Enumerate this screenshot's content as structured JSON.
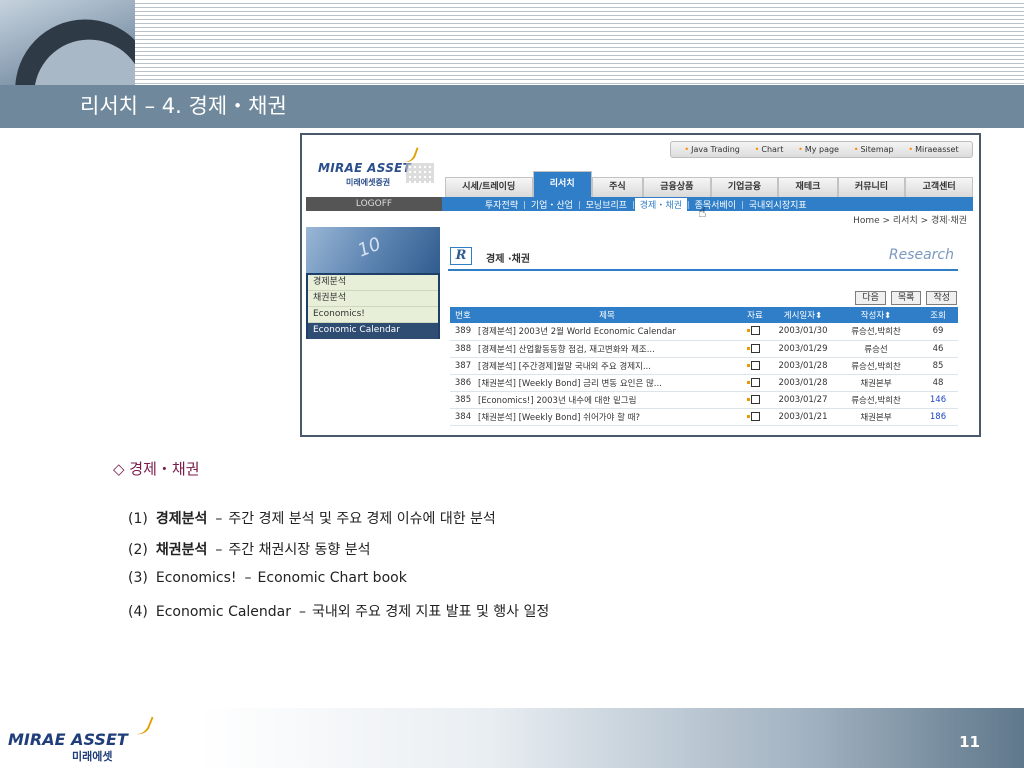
{
  "slide": {
    "title": "리서치 – 4. 경제・채권",
    "section_heading": "◇ 경제・채권",
    "bullets": [
      {
        "num": "(1)",
        "term": "경제분석",
        "dash": "–",
        "desc": "주간 경제 분석 및 주요 경제 이슈에 대한 분석"
      },
      {
        "num": "(2)",
        "term": "채권분석",
        "dash": "–",
        "desc": "주간 채권시장 동향 분석"
      },
      {
        "num": "(3)",
        "term": "Economics!",
        "dash": "–",
        "desc": "Economic Chart book"
      },
      {
        "num": "(4)",
        "term": "Economic Calendar",
        "dash": "–",
        "desc": "국내외 주요 경제 지표 발표 및 행사 일정"
      }
    ],
    "page_number": "11",
    "footer_logo": {
      "main": "MIRAE ASSET",
      "sub": "미래에셋"
    }
  },
  "site": {
    "logo": {
      "main": "MIRAE ASSET",
      "sub": "미래에셋증권"
    },
    "top_links": [
      "Java Trading",
      "Chart",
      "My page",
      "Sitemap",
      "Miraeasset"
    ],
    "main_nav": [
      "시세/트레이딩",
      "리서치",
      "주식",
      "금융상품",
      "기업금융",
      "재테크",
      "커뮤니티",
      "고객센터"
    ],
    "main_nav_active_index": 1,
    "logoff": "LOGOFF",
    "sub_nav": [
      "투자전략",
      "기업・산업",
      "모닝브리프",
      "경제・채권",
      "종목서베이",
      "국내외시장지표"
    ],
    "sub_nav_active_index": 3,
    "breadcrumb": "Home > 리서치 > 경제·채권",
    "side_menu": [
      "경제분석",
      "채권분석",
      "Economics!",
      "Economic Calendar"
    ],
    "side_photo_text": "10",
    "content_title": "경제 ·채권",
    "badge_letter": "R",
    "research_label": "Research",
    "buttons": [
      "다음",
      "목록",
      "작성"
    ],
    "table": {
      "headers": [
        "번호",
        "제목",
        "자료",
        "게시일자",
        "작성자",
        "조회"
      ],
      "rows": [
        {
          "no": "389",
          "title": "[경제분석] 2003년 2월 World Economic Calendar",
          "date": "2003/01/30",
          "author": "류승선,박희찬",
          "views": "69",
          "highlight": false
        },
        {
          "no": "388",
          "title": "[경제분석] 산업활동동향 점검, 재고변화와 제조...",
          "date": "2003/01/29",
          "author": "류승선",
          "views": "46",
          "highlight": false
        },
        {
          "no": "387",
          "title": "[경제분석] [주간경제]월말 국내외 주요 경제지...",
          "date": "2003/01/28",
          "author": "류승선,박희찬",
          "views": "85",
          "highlight": false
        },
        {
          "no": "386",
          "title": "[채권분석] [Weekly Bond] 금리 변동 요인은 많...",
          "date": "2003/01/28",
          "author": "채권본부",
          "views": "48",
          "highlight": false
        },
        {
          "no": "385",
          "title": "[Economics!] 2003년 내수에 대한 밑그림",
          "date": "2003/01/27",
          "author": "류승선,박희찬",
          "views": "146",
          "highlight": true
        },
        {
          "no": "384",
          "title": "[채권분석] [Weekly Bond] 쉬어가야 할 때?",
          "date": "2003/01/21",
          "author": "채권본부",
          "views": "186",
          "highlight": true
        }
      ]
    }
  },
  "colors": {
    "title_bar": "#6f889b",
    "nav_blue": "#2f7ec7",
    "accent_purple": "#7a1b4a"
  }
}
